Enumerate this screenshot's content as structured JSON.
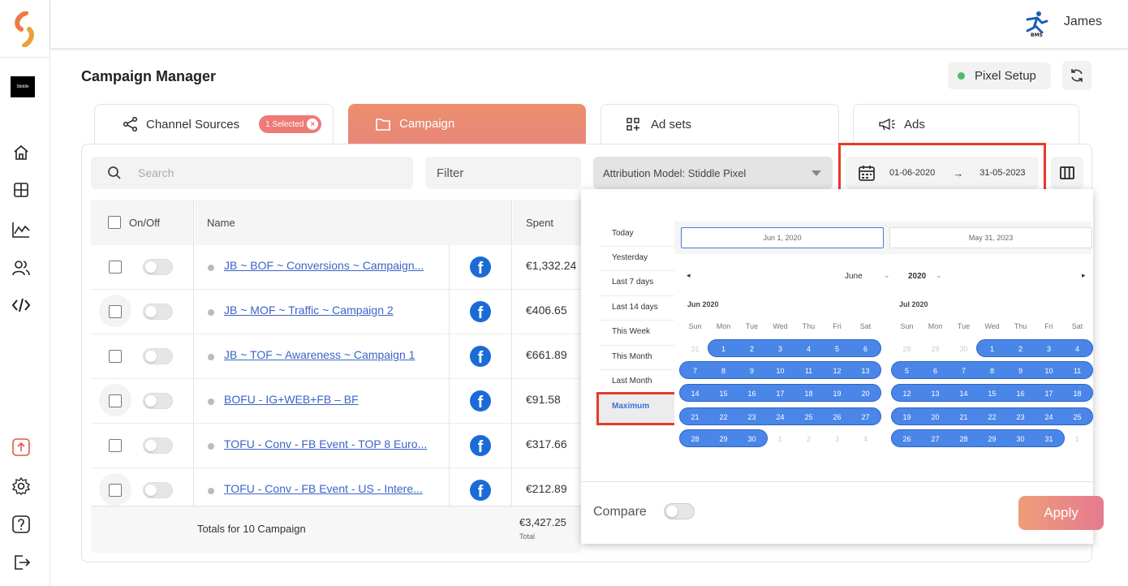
{
  "app": {
    "user_name": "James",
    "brand_short": "Stiddle"
  },
  "page": {
    "title": "Campaign Manager",
    "pixel_setup_label": "Pixel Setup"
  },
  "tabs": [
    {
      "label": "Channel Sources",
      "badge": "1 Selected"
    },
    {
      "label": "Campaign"
    },
    {
      "label": "Ad sets"
    },
    {
      "label": "Ads"
    }
  ],
  "toolbar": {
    "search_placeholder": "Search",
    "filter_label": "Filter",
    "attribution_label": "Attribution Model: Stiddle Pixel",
    "date_from": "01-06-2020",
    "date_arrow": "→",
    "date_to": "31-05-2023"
  },
  "table": {
    "headers": {
      "onoff": "On/Off",
      "name": "Name",
      "spent": "Spent"
    },
    "rows": [
      {
        "name": "JB ~ BOF ~ Conversions ~ Campaign...",
        "spent": "€1,332.24"
      },
      {
        "name": "JB ~ MOF ~ Traffic ~ Campaign 2",
        "spent": "€406.65"
      },
      {
        "name": "JB ~ TOF ~ Awareness ~ Campaign 1",
        "spent": "€661.89"
      },
      {
        "name": "BOFU - IG+WEB+FB – BF",
        "spent": "€91.58"
      },
      {
        "name": "TOFU - Conv - FB Event - TOP 8 Euro...",
        "spent": "€317.66"
      },
      {
        "name": "TOFU - Conv - FB Event - US - Intere...",
        "spent": "€212.89"
      }
    ],
    "totals_label": "Totals for 10 Campaign",
    "totals_spent": "€3,427.25",
    "totals_sub": "Total"
  },
  "datepicker": {
    "presets": [
      "Today",
      "Yesterday",
      "Last 7 days",
      "Last 14 days",
      "This Week",
      "This Month",
      "Last Month",
      "Maximum"
    ],
    "active_preset": "Maximum",
    "start_input": "Jun 1, 2020",
    "end_input": "May 31, 2023",
    "nav_month": "June",
    "nav_year": "2020",
    "prev_arrow": "◂",
    "next_arrow": "▸",
    "weekdays": [
      "Sun",
      "Mon",
      "Tue",
      "Wed",
      "Thu",
      "Fri",
      "Sat"
    ],
    "months": [
      {
        "label": "Jun 2020",
        "lead_days": [
          "31"
        ],
        "days": 30,
        "trail_days": [
          "1",
          "2",
          "3",
          "4"
        ]
      },
      {
        "label": "Jul 2020",
        "lead_days": [
          "28",
          "29",
          "30"
        ],
        "days": 31,
        "trail_days": [
          "1"
        ]
      }
    ],
    "compare_label": "Compare",
    "apply_label": "Apply"
  },
  "colors": {
    "accent_orange": "#ee8f6a",
    "accent_pink": "#e57a90",
    "range_blue": "#4a86e8",
    "highlight_red": "#e63a2b",
    "status_green": "#4cbb6a"
  }
}
